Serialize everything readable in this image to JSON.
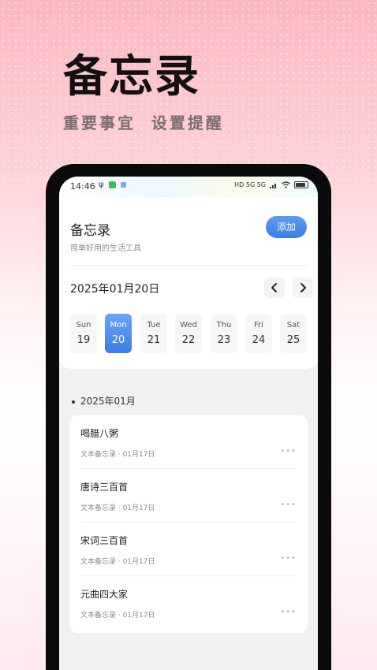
{
  "hero": {
    "title": "备忘录",
    "subtitle": "重要事宜  设置提醒"
  },
  "status_bar": {
    "time": "14:46",
    "indicators": "HD 5G 5G"
  },
  "header": {
    "title": "备忘录",
    "subtitle": "简单好用的生活工具",
    "add_label": "添加"
  },
  "calendar": {
    "current_date": "2025年01月20日",
    "prev_icon": "chevron-left-icon",
    "next_icon": "chevron-right-icon",
    "days": [
      {
        "name": "Sun",
        "date": "19",
        "selected": false
      },
      {
        "name": "Mon",
        "date": "20",
        "selected": true
      },
      {
        "name": "Tue",
        "date": "21",
        "selected": false
      },
      {
        "name": "Wed",
        "date": "22",
        "selected": false
      },
      {
        "name": "Thu",
        "date": "23",
        "selected": false
      },
      {
        "name": "Fri",
        "date": "24",
        "selected": false
      },
      {
        "name": "Sat",
        "date": "25",
        "selected": false
      }
    ]
  },
  "memos": {
    "month": "2025年01月",
    "items": [
      {
        "title": "喝腊八粥",
        "meta": "文本备忘录 · 01月17日"
      },
      {
        "title": "唐诗三百首",
        "meta": "文本备忘录 · 01月17日"
      },
      {
        "title": "宋词三百首",
        "meta": "文本备忘录 · 01月17日"
      },
      {
        "title": "元曲四大家",
        "meta": "文本备忘录 · 01月17日"
      }
    ],
    "more_glyph": "•••"
  },
  "colors": {
    "accent": "#3b7ee6",
    "accent_light": "#6aa6f5",
    "hero_pink": "#fbb8c0"
  }
}
